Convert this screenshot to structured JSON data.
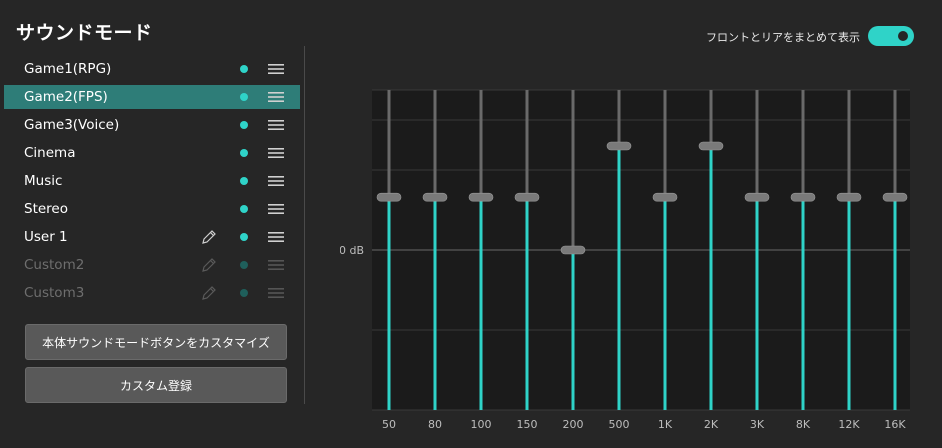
{
  "title": "サウンドモード",
  "toggle": {
    "label": "フロントとリアをまとめて表示",
    "on": true,
    "color": "#2fd3c8"
  },
  "presets": [
    {
      "name": "Game1(RPG)",
      "selected": false,
      "enabled": true,
      "editable": false
    },
    {
      "name": "Game2(FPS)",
      "selected": true,
      "enabled": true,
      "editable": false
    },
    {
      "name": "Game3(Voice)",
      "selected": false,
      "enabled": true,
      "editable": false
    },
    {
      "name": "Cinema",
      "selected": false,
      "enabled": true,
      "editable": false
    },
    {
      "name": "Music",
      "selected": false,
      "enabled": true,
      "editable": false
    },
    {
      "name": "Stereo",
      "selected": false,
      "enabled": true,
      "editable": false
    },
    {
      "name": "User 1",
      "selected": false,
      "enabled": true,
      "editable": true
    },
    {
      "name": "Custom2",
      "selected": false,
      "enabled": false,
      "editable": true
    },
    {
      "name": "Custom3",
      "selected": false,
      "enabled": false,
      "editable": true
    }
  ],
  "buttons": {
    "customize": "本体サウンドモードボタンをカスタマイズ",
    "register": "カスタム登録"
  },
  "eq": {
    "zero_label": "0 dB",
    "bands": [
      "50",
      "80",
      "100",
      "150",
      "200",
      "500",
      "1K",
      "2K",
      "3K",
      "8K",
      "12K",
      "16K"
    ],
    "levels": [
      0.33,
      0.33,
      0.33,
      0.33,
      0.0,
      0.65,
      0.33,
      0.65,
      0.33,
      0.33,
      0.33,
      0.33
    ],
    "accent": "#2fd3c8"
  }
}
